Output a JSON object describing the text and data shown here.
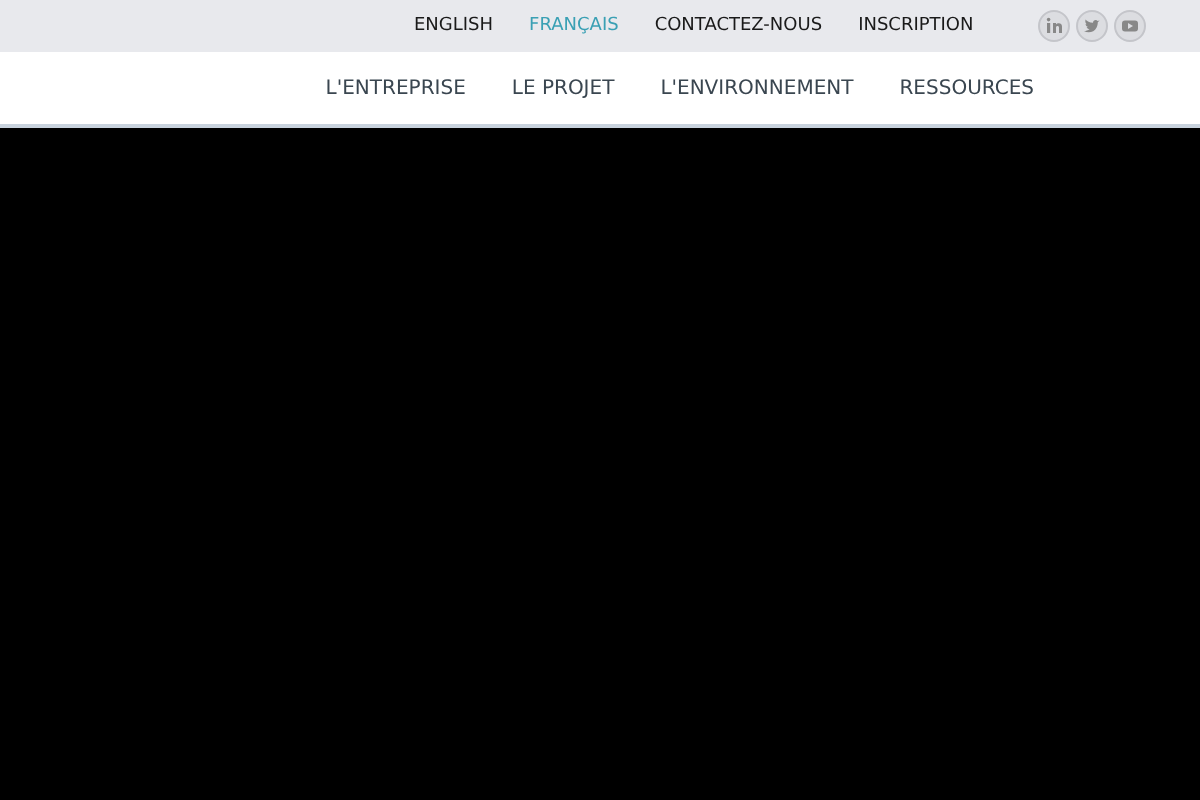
{
  "top_links": [
    {
      "label": "ENGLISH",
      "selected": false
    },
    {
      "label": "FRANÇAIS",
      "selected": true
    },
    {
      "label": "CONTACTEZ-NOUS",
      "selected": false
    },
    {
      "label": "INSCRIPTION",
      "selected": false
    }
  ],
  "social": [
    {
      "kind": "linkedin"
    },
    {
      "kind": "twitter"
    },
    {
      "kind": "youtube"
    }
  ],
  "nav": [
    "L'ENTREPRISE",
    "LE PROJET",
    "L'ENVIRONNEMENT",
    "RESSOURCES"
  ],
  "hero": {
    "kind": "video"
  }
}
